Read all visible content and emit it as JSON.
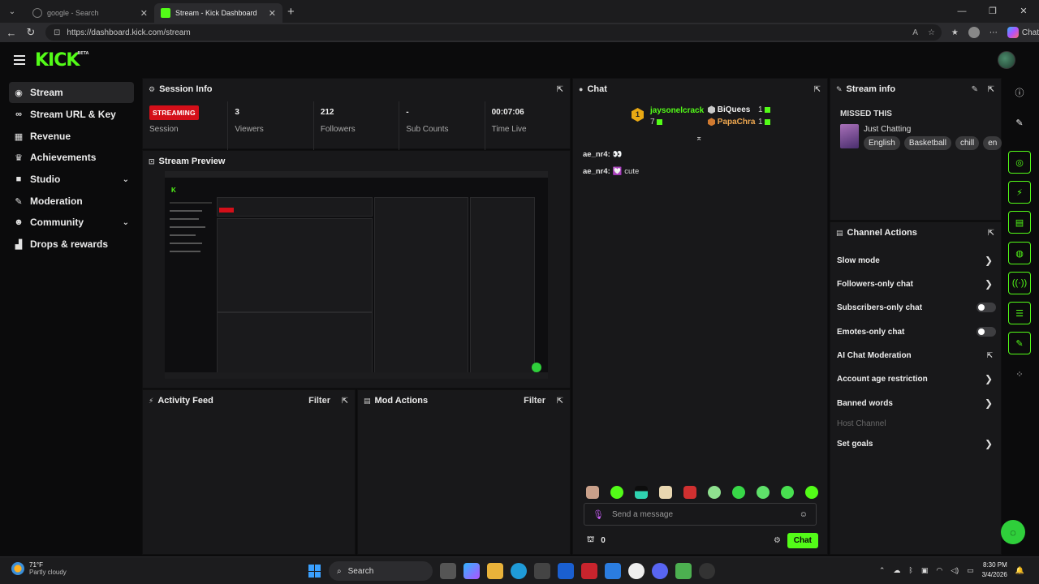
{
  "browser": {
    "tabs": [
      {
        "title": "google - Search",
        "active": false
      },
      {
        "title": "Stream - Kick Dashboard",
        "active": true
      }
    ],
    "url": "https://dashboard.kick.com/stream",
    "copilot_label": "Chat"
  },
  "app": {
    "logo": "KICK",
    "logo_badge": "BETA",
    "accent": "#53fc18"
  },
  "sidebar": {
    "items": [
      {
        "label": "Stream",
        "icon": "broadcast-icon",
        "glyph": "((·))",
        "active": true
      },
      {
        "label": "Stream URL & Key",
        "icon": "link-icon",
        "glyph": "⛓"
      },
      {
        "label": "Revenue",
        "icon": "bank-icon",
        "glyph": "🏛"
      },
      {
        "label": "Achievements",
        "icon": "trophy-icon",
        "glyph": "🏆"
      },
      {
        "label": "Studio",
        "icon": "camera-icon",
        "glyph": "■",
        "expandable": true
      },
      {
        "label": "Moderation",
        "icon": "wrench-icon",
        "glyph": "🔧"
      },
      {
        "label": "Community",
        "icon": "users-icon",
        "glyph": "👥",
        "expandable": true
      },
      {
        "label": "Drops & rewards",
        "icon": "chart-icon",
        "glyph": "▟"
      }
    ]
  },
  "session_info": {
    "title": "Session Info",
    "status_badge": "STREAMING",
    "stats": [
      {
        "value": "",
        "label": "Session"
      },
      {
        "value": "3",
        "label": "Viewers"
      },
      {
        "value": "212",
        "label": "Followers"
      },
      {
        "value": "-",
        "label": "Sub Counts"
      },
      {
        "value": "00:07:06",
        "label": "Time Live"
      }
    ]
  },
  "stream_preview": {
    "title": "Stream Preview"
  },
  "activity_feed": {
    "title": "Activity Feed",
    "filter": "Filter"
  },
  "mod_actions": {
    "title": "Mod Actions",
    "filter": "Filter"
  },
  "chat": {
    "title": "Chat",
    "leaderboard": {
      "first": {
        "rank": "1",
        "name": "jaysonelcrack",
        "count": "7"
      },
      "second": {
        "name": "BiQuees",
        "count": "1"
      },
      "third": {
        "name": "PapaChra",
        "count": "1"
      }
    },
    "messages": [
      {
        "user": "ae_nr4:",
        "text": "👀"
      },
      {
        "user": "ae_nr4:",
        "text": "💟 cute"
      }
    ],
    "input_placeholder": "Send a message",
    "points": "0",
    "send_label": "Chat"
  },
  "stream_info": {
    "title": "Stream info",
    "stream_title": "MISSED THIS",
    "category": "Just Chatting",
    "tags": [
      "English",
      "Basketball",
      "chill",
      "en"
    ]
  },
  "channel_actions": {
    "title": "Channel Actions",
    "items": [
      {
        "label": "Slow mode",
        "control": "arrow"
      },
      {
        "label": "Followers-only chat",
        "control": "arrow"
      },
      {
        "label": "Subscribers-only chat",
        "control": "toggle"
      },
      {
        "label": "Emotes-only chat",
        "control": "toggle"
      },
      {
        "label": "AI Chat Moderation",
        "control": "external"
      },
      {
        "label": "Account age restriction",
        "control": "arrow"
      },
      {
        "label": "Banned words",
        "control": "arrow"
      },
      {
        "label": "Host Channel",
        "control": "none",
        "disabled": true
      },
      {
        "label": "Set goals",
        "control": "arrow"
      }
    ]
  },
  "taskbar": {
    "weather_temp": "71°F",
    "weather_desc": "Partly cloudy",
    "search_label": "Search",
    "time": "8:30 PM",
    "date": "3/4/2026"
  }
}
